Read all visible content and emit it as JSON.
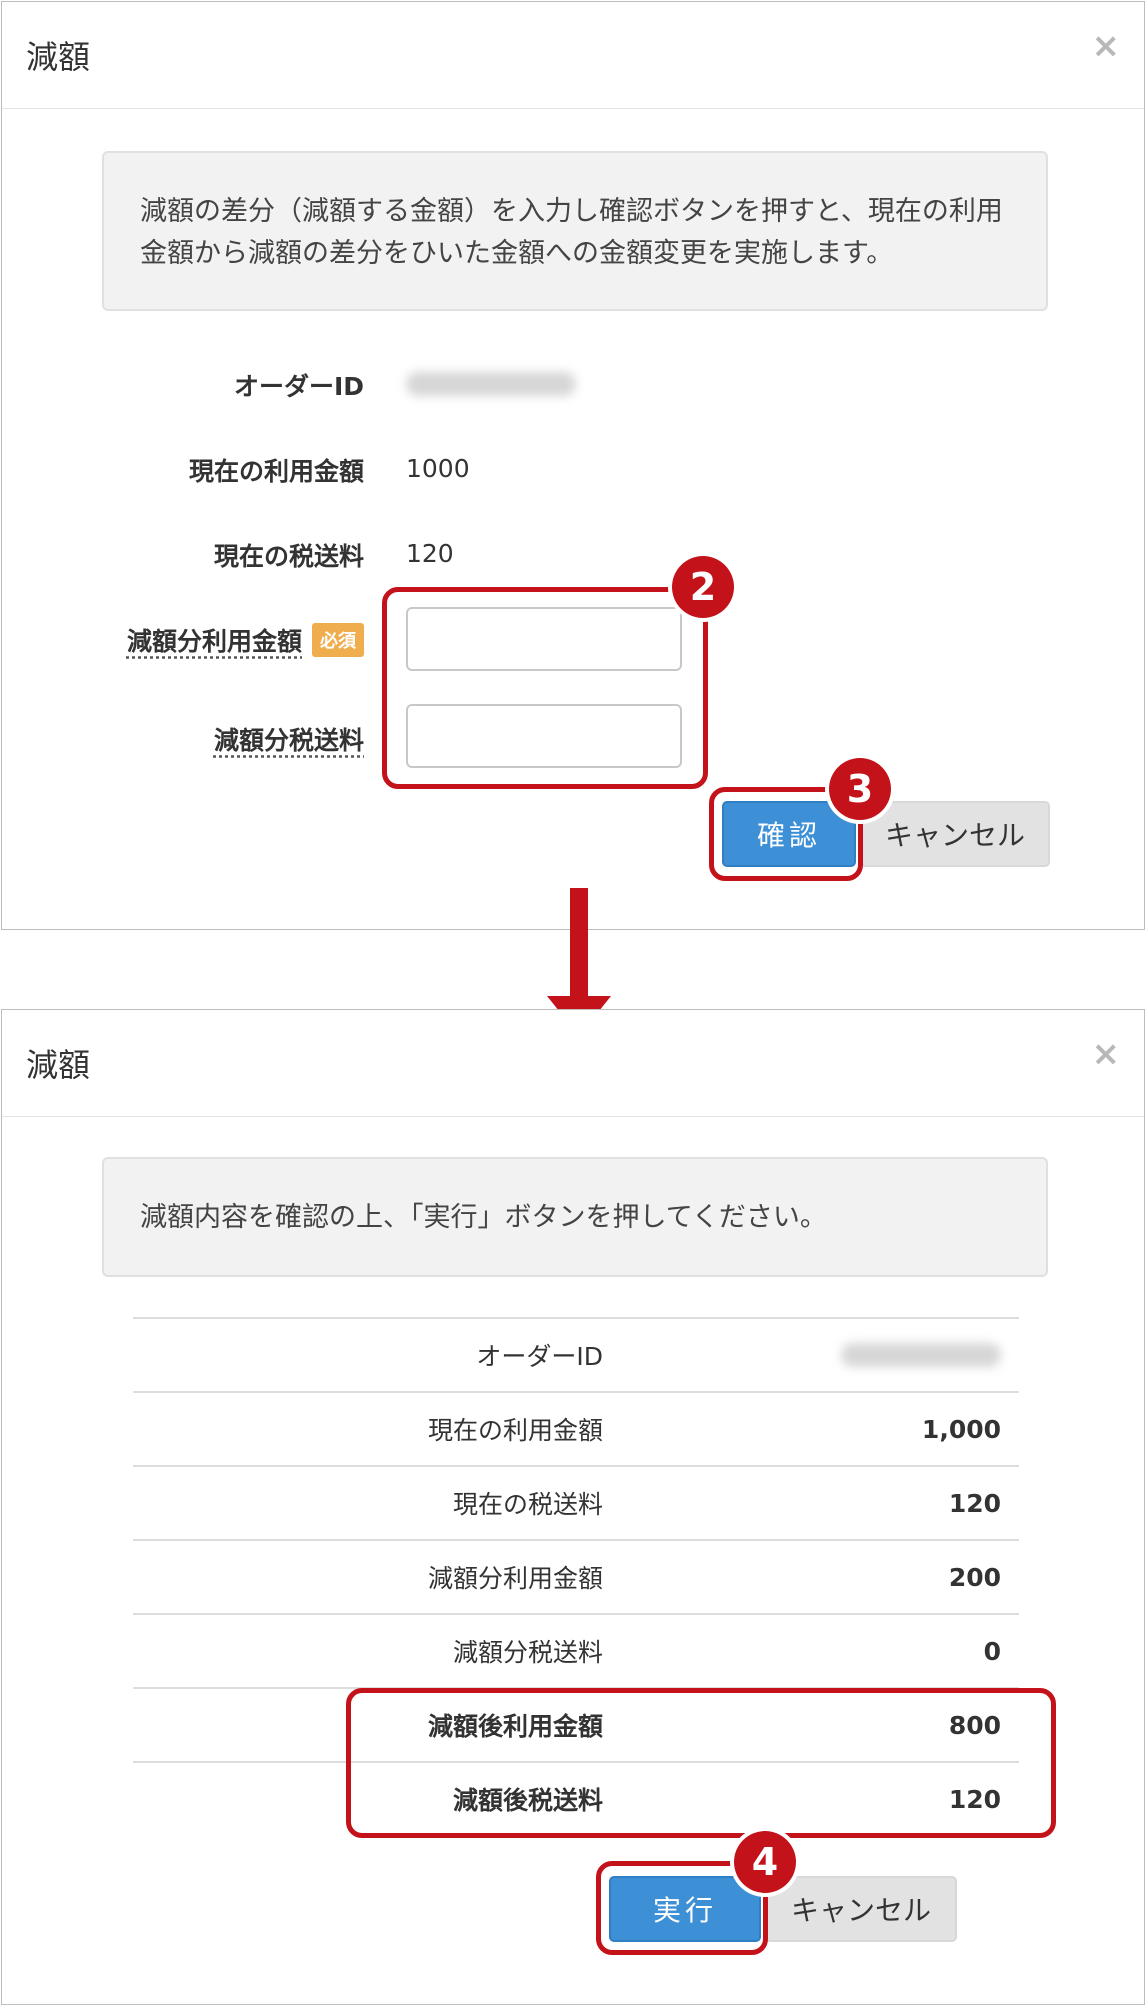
{
  "close_symbol": "×",
  "step1": {
    "title": "減額",
    "info_text": "減額の差分（減額する金額）を入力し確認ボタンを押すと、現在の利用金額から減額の差分をひいた金額への金額変更を実施します。",
    "fields": {
      "order_id_label": "オーダーID",
      "current_amount_label": "現在の利用金額",
      "current_amount_value": "1000",
      "current_tax_label": "現在の税送料",
      "current_tax_value": "120",
      "reduce_amount_label": "減額分利用金額",
      "required_badge": "必須",
      "reduce_tax_label": "減額分税送料"
    },
    "confirm_button": "確認",
    "cancel_button": "キャンセル",
    "badge_inputs": "2",
    "badge_confirm": "3"
  },
  "step2": {
    "title": "減額",
    "info_text": "減額内容を確認の上、「実行」ボタンを押してください。",
    "rows": [
      {
        "label": "オーダーID",
        "value": ""
      },
      {
        "label": "現在の利用金額",
        "value": "1,000"
      },
      {
        "label": "現在の税送料",
        "value": "120"
      },
      {
        "label": "減額分利用金額",
        "value": "200"
      },
      {
        "label": "減額分税送料",
        "value": "0"
      },
      {
        "label": "減額後利用金額",
        "value": "800"
      },
      {
        "label": "減額後税送料",
        "value": "120"
      }
    ],
    "execute_button": "実行",
    "cancel_button": "キャンセル",
    "badge_execute": "4"
  },
  "colors": {
    "primary": "#3d8fd6",
    "highlight_red": "#c4121a",
    "required_orange": "#f0ad4e"
  }
}
